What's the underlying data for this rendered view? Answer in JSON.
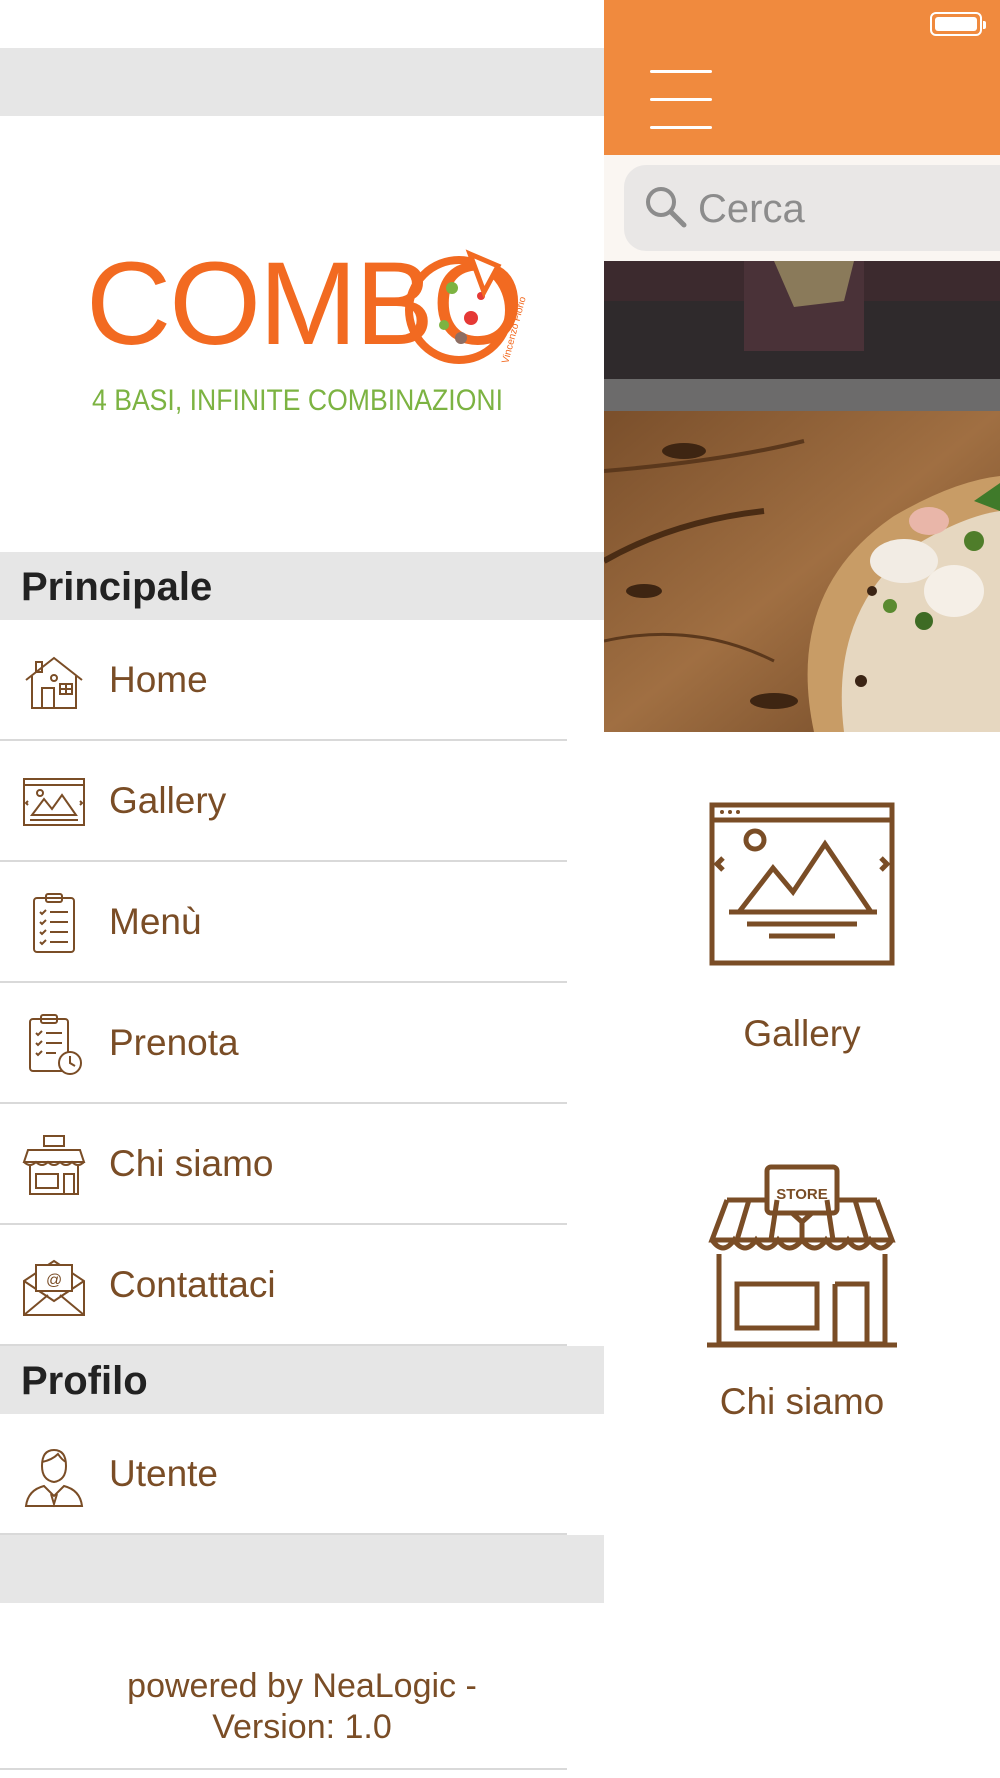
{
  "drawer": {
    "logo": {
      "brand": "COMBO",
      "signature": "Vincenzo Fiorio",
      "tagline": "4 BASI, INFINITE COMBINAZIONI"
    },
    "sections": [
      {
        "title": "Principale",
        "items": [
          {
            "label": "Home",
            "icon": "home-icon"
          },
          {
            "label": "Gallery",
            "icon": "gallery-icon"
          },
          {
            "label": "Menù",
            "icon": "clipboard-list-icon"
          },
          {
            "label": "Prenota",
            "icon": "clipboard-clock-icon"
          },
          {
            "label": "Chi siamo",
            "icon": "store-icon"
          },
          {
            "label": "Contattaci",
            "icon": "envelope-at-icon"
          }
        ]
      },
      {
        "title": "Profilo",
        "items": [
          {
            "label": "Utente",
            "icon": "user-icon"
          }
        ]
      }
    ],
    "footer": {
      "line1": "powered by NeaLogic -",
      "line2": "Version: 1.0"
    }
  },
  "main": {
    "search": {
      "placeholder": "Cerca",
      "value": ""
    },
    "tiles": [
      {
        "label": "Gallery",
        "icon": "gallery-icon"
      },
      {
        "label": "Chi siamo",
        "icon": "store-icon",
        "sign": "STORE"
      }
    ]
  },
  "colors": {
    "accent": "#f08a3e",
    "brown": "#7a4d26",
    "logo_orange": "#f26a21",
    "logo_green": "#7cb342",
    "section_gray": "#e6e6e6"
  }
}
